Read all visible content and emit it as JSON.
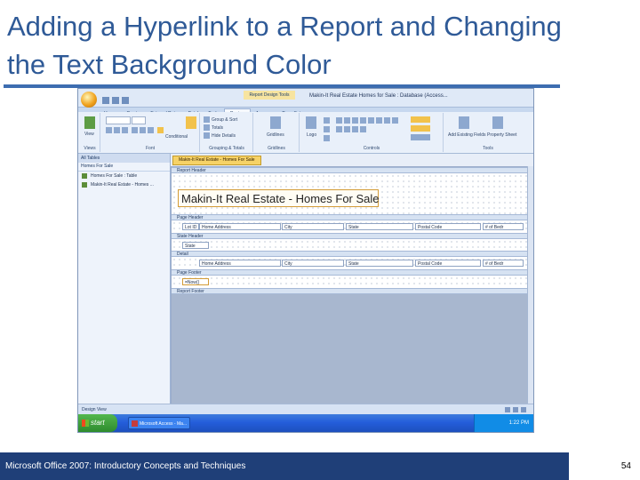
{
  "slide": {
    "title": "Adding a Hyperlink to a Report and Changing the Text Background Color",
    "footer": "Microsoft Office 2007: Introductory Concepts and Techniques",
    "page_number": "54"
  },
  "colors": {
    "title_text": "#2f5a97",
    "accent_rule": "#3d6db0",
    "footer_bar": "#1f3f78",
    "taskbar": "#245edb",
    "start_button": "#2e8b2e"
  },
  "access": {
    "context_tools_label": "Report Design Tools",
    "window_title": "Makin-It Real Estate Homes for Sale : Database (Access...",
    "tabs": [
      "Home",
      "Create",
      "External Data",
      "Database Tools",
      "Design",
      "Arrange",
      "Page Setup"
    ],
    "ribbon_groups": {
      "views": "Views",
      "font": "Font",
      "grouping": "Grouping & Totals",
      "gridlines": "Gridlines",
      "controls": "Controls",
      "tools": "Tools"
    },
    "ribbon_texts": {
      "view": "View",
      "conditional": "Conditional",
      "group_sort": "Group & Sort",
      "totals": "Totals",
      "hide_details": "Hide Details",
      "gridlines_btn": "Gridlines",
      "logo": "Logo",
      "add_existing_fields": "Add Existing Fields",
      "property_sheet": "Property Sheet"
    },
    "nav": {
      "header": "All Tables",
      "group": "Homes For Sale",
      "items": [
        "Homes For Sale : Table",
        "Makin-It Real Estate - Homes ..."
      ]
    },
    "doc_tab": "Makin-It Real Estate - Homes For Sale",
    "sections": {
      "report_header": "Report Header",
      "page_header": "Page Header",
      "state_header": "State Header",
      "detail": "Detail",
      "page_footer": "Page Footer",
      "report_footer": "Report Footer"
    },
    "report_title": "Makin-It Real Estate - Homes For Sale",
    "page_header_fields": [
      "Lot ID",
      "Home Address",
      "City",
      "State",
      "Postal Code",
      "# of Bedr"
    ],
    "group_field": "State",
    "detail_fields": [
      "Home Address",
      "City",
      "State",
      "Postal Code",
      "# of Bedr"
    ],
    "page_footer_field": "=Now()",
    "status": "Design View",
    "taskbar": {
      "start": "start",
      "item": "Microsoft Access - Ma...",
      "clock": "1:22 PM"
    }
  }
}
